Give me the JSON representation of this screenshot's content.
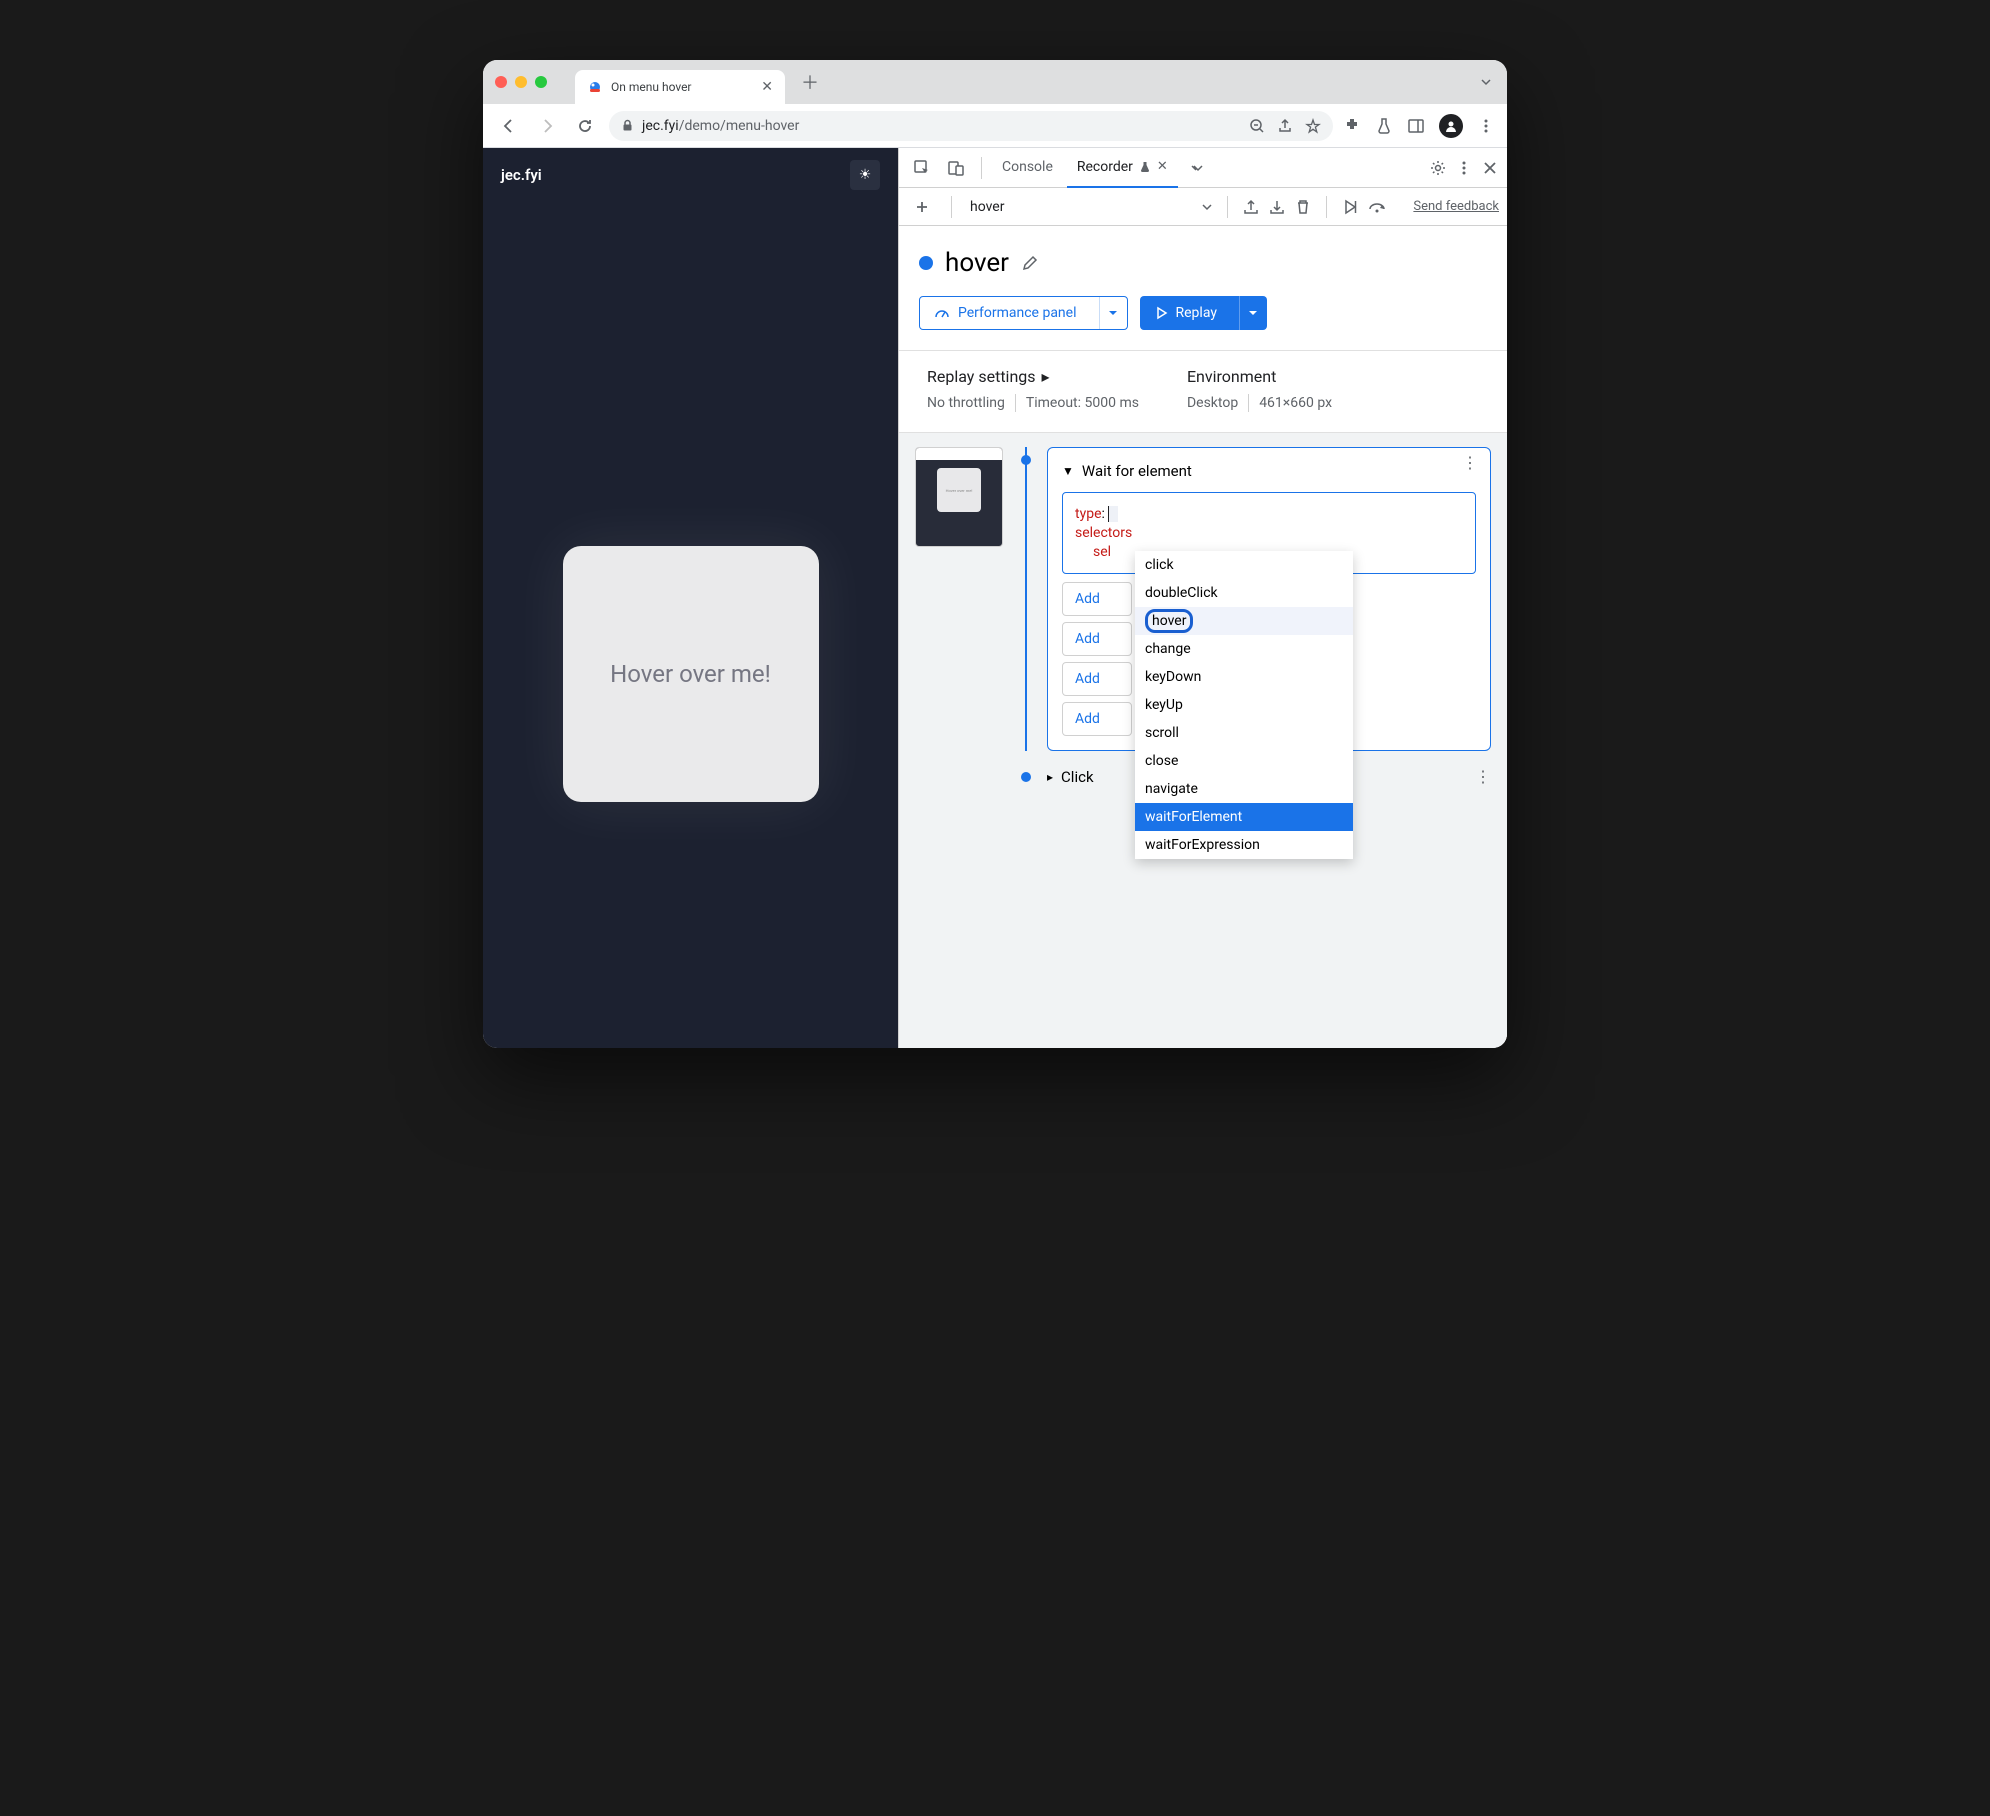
{
  "window": {
    "tab_title": "On menu hover",
    "url_host": "jec.fyi",
    "url_path": "/demo/menu-hover"
  },
  "page": {
    "brand": "jec.fyi",
    "hover_label": "Hover over me!"
  },
  "devtools": {
    "tabs": {
      "console": "Console",
      "recorder": "Recorder"
    },
    "recording_name": "hover",
    "feedback": "Send feedback",
    "title": "hover",
    "perf_button": "Performance panel",
    "replay_button": "Replay"
  },
  "settings": {
    "replay_title": "Replay settings",
    "throttling": "No throttling",
    "timeout": "Timeout: 5000 ms",
    "env_title": "Environment",
    "device": "Desktop",
    "viewport": "461×660 px"
  },
  "thumb_text": "Hover over me!",
  "step1": {
    "title": "Wait for element",
    "type_key": "type",
    "selectors_key": "selectors",
    "sel_key": "sel",
    "add_label": "Add"
  },
  "type_options": {
    "click": "click",
    "doubleClick": "doubleClick",
    "hover": "hover",
    "change": "change",
    "keyDown": "keyDown",
    "keyUp": "keyUp",
    "scroll": "scroll",
    "close": "close",
    "navigate": "navigate",
    "waitForElement": "waitForElement",
    "waitForExpression": "waitForExpression"
  },
  "step2": {
    "title": "Click"
  }
}
